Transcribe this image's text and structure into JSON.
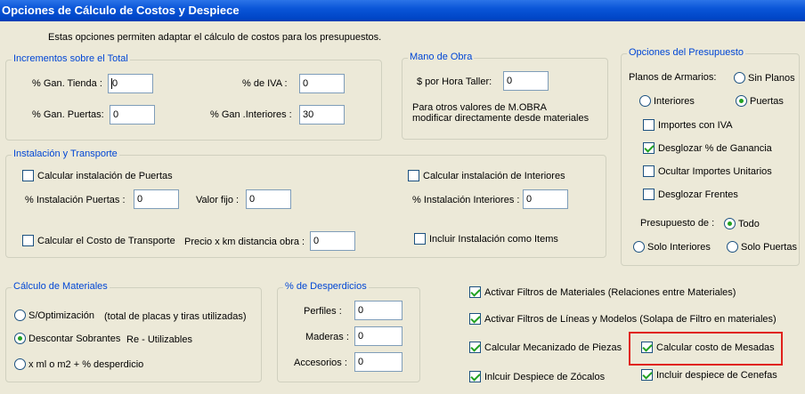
{
  "window": {
    "title": "Opciones de Cálculo de Costos y Despiece"
  },
  "intro_text": "Estas opciones permiten adaptar el cálculo de costos para los presupuestos.",
  "incrementos": {
    "title": "Incrementos sobre el Total",
    "gan_tienda_label": "% Gan. Tienda :",
    "gan_tienda_value": "0",
    "iva_label": "% de IVA :",
    "iva_value": "0",
    "gan_puertas_label": "% Gan. Puertas:",
    "gan_puertas_value": "0",
    "gan_interiores_label": "% Gan .Interiores :",
    "gan_interiores_value": "30"
  },
  "mano_obra": {
    "title": "Mano de Obra",
    "hora_label": "$ por Hora Taller:",
    "hora_value": "0",
    "note_line1": "Para otros valores de M.OBRA",
    "note_line2": "modificar directamente desde materiales"
  },
  "opciones_presupuesto": {
    "title": "Opciones del Presupuesto",
    "planos_label": "Planos de Armarios:",
    "sin_planos": "Sin Planos",
    "interiores": "Interiores",
    "puertas": "Puertas",
    "importes_iva": "Importes con IVA",
    "desglozar_ganancia": "Desglozar % de Ganancia",
    "ocultar_importes": "Ocultar Importes Unitarios",
    "desglozar_frentes": "Desglozar Frentes",
    "presupuesto_de": "Presupuesto de :",
    "todo": "Todo",
    "solo_interiores": "Solo Interiores",
    "solo_puertas": "Solo Puertas"
  },
  "instalacion": {
    "title": "Instalación y Transporte",
    "calc_puertas": "Calcular instalación de Puertas",
    "inst_puertas_label": "% Instalación Puertas :",
    "inst_puertas_value": "0",
    "valor_fijo_label": "Valor fijo :",
    "valor_fijo_value": "0",
    "calc_interiores": "Calcular instalación de Interiores",
    "inst_interiores_label": "% Instalación Interiores :",
    "inst_interiores_value": "0",
    "calc_transporte": "Calcular el Costo de Transporte",
    "precio_km_label": "Precio x km distancia obra :",
    "precio_km_value": "0",
    "incluir_items": "Incluir Instalación como Items"
  },
  "materiales": {
    "title": "Cálculo de Materiales",
    "sopt": "S/Optimización",
    "sopt_note": "(total de placas y tiras utilizadas)",
    "descontar": "Descontar Sobrantes",
    "descontar_note": "Re - Utilizables",
    "xml": "x ml o m2 + % desperdicio"
  },
  "desperdicios": {
    "title": "% de Desperdicios",
    "perfiles_label": "Perfiles :",
    "perfiles_value": "0",
    "maderas_label": "Maderas :",
    "maderas_value": "0",
    "accesorios_label": "Accesorios :",
    "accesorios_value": "0"
  },
  "otros": {
    "filtros_materiales": "Activar Filtros de Materiales (Relaciones entre Materiales)",
    "filtros_lineas": "Activar Filtros de Líneas y Modelos (Solapa de Filtro en materiales)",
    "mecanizado": "Calcular Mecanizado de Piezas",
    "mesadas": "Calcular costo de Mesadas",
    "zocalos": "Inlcuir Despiece de Zócalos",
    "cenefas": "Incluir despiece de Cenefas"
  },
  "colors": {
    "title_bar": "#0a55d8",
    "group_title": "#0046d5",
    "check": "#21a121",
    "highlight": "#e0211b"
  }
}
